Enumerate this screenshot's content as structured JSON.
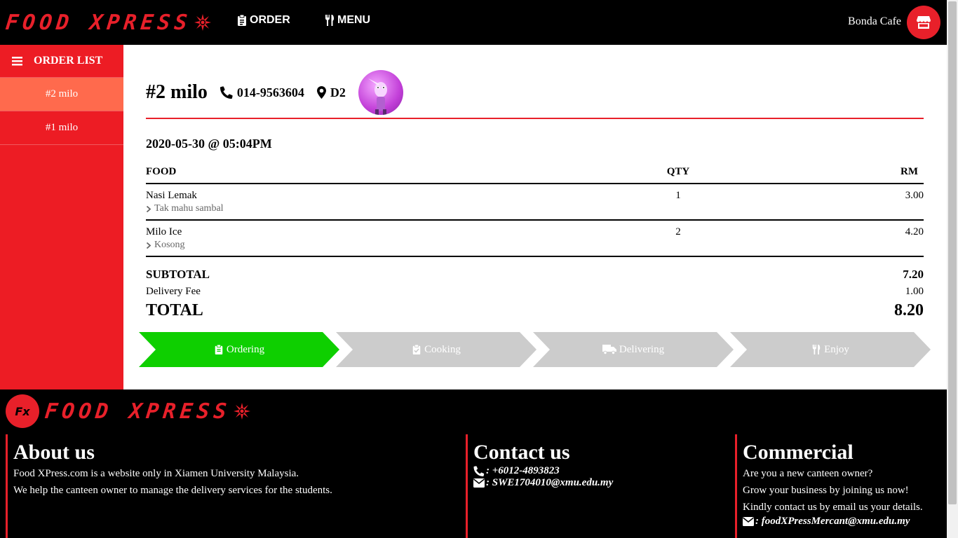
{
  "nav": {
    "brand": "FOOD XPRESS",
    "order_label": "ORDER",
    "menu_label": "MENU",
    "cafe_name": "Bonda Cafe"
  },
  "sidebar": {
    "title": "ORDER LIST",
    "items": [
      {
        "label": "#2 milo",
        "active": true
      },
      {
        "label": "#1 milo",
        "active": false
      }
    ]
  },
  "order": {
    "title": "#2 milo",
    "phone": "014-9563604",
    "location": "D2",
    "datetime": "2020-05-30 @ 05:04PM",
    "columns": {
      "food": "FOOD",
      "qty": "QTY",
      "rm": "RM"
    },
    "items": [
      {
        "name": "Nasi Lemak",
        "note": "Tak mahu sambal",
        "qty": "1",
        "price": "3.00"
      },
      {
        "name": "Milo Ice",
        "note": "Kosong",
        "qty": "2",
        "price": "4.20"
      }
    ],
    "subtotal_label": "SUBTOTAL",
    "subtotal": "7.20",
    "delivery_label": "Delivery Fee",
    "delivery": "1.00",
    "total_label": "TOTAL",
    "total": "8.20"
  },
  "progress": {
    "active_color": "#0ecf00",
    "inactive_color": "#cccccc",
    "steps": [
      {
        "label": "Ordering",
        "icon": "clipboard-icon",
        "active": true
      },
      {
        "label": "Cooking",
        "icon": "clipboard-check-icon",
        "active": false
      },
      {
        "label": "Delivering",
        "icon": "truck-icon",
        "active": false
      },
      {
        "label": "Enjoy",
        "icon": "utensils-icon",
        "active": false
      }
    ]
  },
  "footer": {
    "logo_text": "Fx",
    "brand": "FOOD XPRESS",
    "about": {
      "title": "About us",
      "lines": [
        "Food XPress.com is a website only in Xiamen University Malaysia.",
        "We help the canteen owner to manage the delivery services for the students."
      ]
    },
    "contact": {
      "title": "Contact us",
      "phone": ": +6012-4893823",
      "email": ": SWE1704010@xmu.edu.my"
    },
    "commercial": {
      "title": "Commercial",
      "lines": [
        "Are you a new canteen owner?",
        "Grow your business by joining us now!",
        "Kindly contact us by email us your details."
      ],
      "email": ": foodXPressMercant@xmu.edu.my"
    }
  },
  "colors": {
    "brand_red": "#e8202a",
    "sidebar_red": "#ed1c24",
    "active_item": "#ff6a4d"
  }
}
